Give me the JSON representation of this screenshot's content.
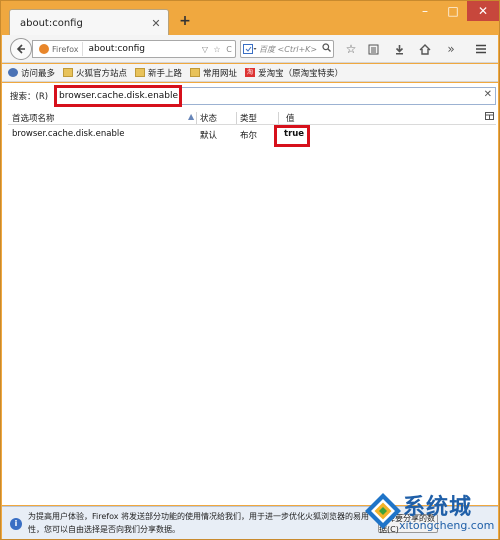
{
  "tab": {
    "title": "about:config",
    "new_tab": "+"
  },
  "window_controls": {
    "minimize": "–",
    "maximize": "□",
    "close": "✕"
  },
  "navbar": {
    "identity_label": "Firefox",
    "url": "about:config",
    "search_placeholder": "百度 <Ctrl+K>",
    "icons": [
      "back-icon",
      "dropdown-icon",
      "refresh-icon",
      "search-go-icon",
      "bookmark-star-icon",
      "reading-list-icon",
      "download-icon",
      "home-icon",
      "overflow-icon",
      "menu-icon"
    ]
  },
  "bookmarks": [
    {
      "label": "访问最多",
      "icon": "gear-icon"
    },
    {
      "label": "火狐官方站点",
      "icon": "folder-icon"
    },
    {
      "label": "新手上路",
      "icon": "folder-icon"
    },
    {
      "label": "常用网址",
      "icon": "folder-icon"
    },
    {
      "label": "爱淘宝（原淘宝特卖）",
      "icon": "taobao-icon"
    }
  ],
  "config": {
    "search_label": "搜索：(R)",
    "search_value": "browser.cache.disk.enable",
    "columns": [
      "首选项名称",
      "状态",
      "类型",
      "值"
    ],
    "rows": [
      {
        "name": "browser.cache.disk.enable",
        "status": "默认",
        "type": "布尔",
        "value": "true"
      }
    ]
  },
  "notification": {
    "text": "为提高用户体验，Firefox 将发送部分功能的使用情况给我们，用于进一步优化火狐浏览器的易用性，您可以自由选择是否向我们分享数据。",
    "button": "选择要分享的数据(C)"
  },
  "watermark": {
    "title": "系统城",
    "subtitle": "xitongcheng.com"
  },
  "colors": {
    "highlight": "#d6101b",
    "frame": "#f0a83f",
    "accent": "#3a6fc4"
  }
}
